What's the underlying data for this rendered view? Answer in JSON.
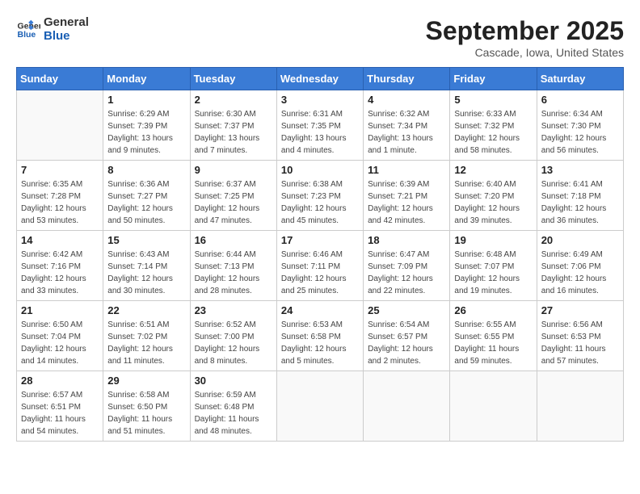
{
  "header": {
    "logo_line1": "General",
    "logo_line2": "Blue",
    "month_title": "September 2025",
    "subtitle": "Cascade, Iowa, United States"
  },
  "weekdays": [
    "Sunday",
    "Monday",
    "Tuesday",
    "Wednesday",
    "Thursday",
    "Friday",
    "Saturday"
  ],
  "weeks": [
    [
      {
        "day": "",
        "detail": ""
      },
      {
        "day": "1",
        "detail": "Sunrise: 6:29 AM\nSunset: 7:39 PM\nDaylight: 13 hours\nand 9 minutes."
      },
      {
        "day": "2",
        "detail": "Sunrise: 6:30 AM\nSunset: 7:37 PM\nDaylight: 13 hours\nand 7 minutes."
      },
      {
        "day": "3",
        "detail": "Sunrise: 6:31 AM\nSunset: 7:35 PM\nDaylight: 13 hours\nand 4 minutes."
      },
      {
        "day": "4",
        "detail": "Sunrise: 6:32 AM\nSunset: 7:34 PM\nDaylight: 13 hours\nand 1 minute."
      },
      {
        "day": "5",
        "detail": "Sunrise: 6:33 AM\nSunset: 7:32 PM\nDaylight: 12 hours\nand 58 minutes."
      },
      {
        "day": "6",
        "detail": "Sunrise: 6:34 AM\nSunset: 7:30 PM\nDaylight: 12 hours\nand 56 minutes."
      }
    ],
    [
      {
        "day": "7",
        "detail": "Sunrise: 6:35 AM\nSunset: 7:28 PM\nDaylight: 12 hours\nand 53 minutes."
      },
      {
        "day": "8",
        "detail": "Sunrise: 6:36 AM\nSunset: 7:27 PM\nDaylight: 12 hours\nand 50 minutes."
      },
      {
        "day": "9",
        "detail": "Sunrise: 6:37 AM\nSunset: 7:25 PM\nDaylight: 12 hours\nand 47 minutes."
      },
      {
        "day": "10",
        "detail": "Sunrise: 6:38 AM\nSunset: 7:23 PM\nDaylight: 12 hours\nand 45 minutes."
      },
      {
        "day": "11",
        "detail": "Sunrise: 6:39 AM\nSunset: 7:21 PM\nDaylight: 12 hours\nand 42 minutes."
      },
      {
        "day": "12",
        "detail": "Sunrise: 6:40 AM\nSunset: 7:20 PM\nDaylight: 12 hours\nand 39 minutes."
      },
      {
        "day": "13",
        "detail": "Sunrise: 6:41 AM\nSunset: 7:18 PM\nDaylight: 12 hours\nand 36 minutes."
      }
    ],
    [
      {
        "day": "14",
        "detail": "Sunrise: 6:42 AM\nSunset: 7:16 PM\nDaylight: 12 hours\nand 33 minutes."
      },
      {
        "day": "15",
        "detail": "Sunrise: 6:43 AM\nSunset: 7:14 PM\nDaylight: 12 hours\nand 30 minutes."
      },
      {
        "day": "16",
        "detail": "Sunrise: 6:44 AM\nSunset: 7:13 PM\nDaylight: 12 hours\nand 28 minutes."
      },
      {
        "day": "17",
        "detail": "Sunrise: 6:46 AM\nSunset: 7:11 PM\nDaylight: 12 hours\nand 25 minutes."
      },
      {
        "day": "18",
        "detail": "Sunrise: 6:47 AM\nSunset: 7:09 PM\nDaylight: 12 hours\nand 22 minutes."
      },
      {
        "day": "19",
        "detail": "Sunrise: 6:48 AM\nSunset: 7:07 PM\nDaylight: 12 hours\nand 19 minutes."
      },
      {
        "day": "20",
        "detail": "Sunrise: 6:49 AM\nSunset: 7:06 PM\nDaylight: 12 hours\nand 16 minutes."
      }
    ],
    [
      {
        "day": "21",
        "detail": "Sunrise: 6:50 AM\nSunset: 7:04 PM\nDaylight: 12 hours\nand 14 minutes."
      },
      {
        "day": "22",
        "detail": "Sunrise: 6:51 AM\nSunset: 7:02 PM\nDaylight: 12 hours\nand 11 minutes."
      },
      {
        "day": "23",
        "detail": "Sunrise: 6:52 AM\nSunset: 7:00 PM\nDaylight: 12 hours\nand 8 minutes."
      },
      {
        "day": "24",
        "detail": "Sunrise: 6:53 AM\nSunset: 6:58 PM\nDaylight: 12 hours\nand 5 minutes."
      },
      {
        "day": "25",
        "detail": "Sunrise: 6:54 AM\nSunset: 6:57 PM\nDaylight: 12 hours\nand 2 minutes."
      },
      {
        "day": "26",
        "detail": "Sunrise: 6:55 AM\nSunset: 6:55 PM\nDaylight: 11 hours\nand 59 minutes."
      },
      {
        "day": "27",
        "detail": "Sunrise: 6:56 AM\nSunset: 6:53 PM\nDaylight: 11 hours\nand 57 minutes."
      }
    ],
    [
      {
        "day": "28",
        "detail": "Sunrise: 6:57 AM\nSunset: 6:51 PM\nDaylight: 11 hours\nand 54 minutes."
      },
      {
        "day": "29",
        "detail": "Sunrise: 6:58 AM\nSunset: 6:50 PM\nDaylight: 11 hours\nand 51 minutes."
      },
      {
        "day": "30",
        "detail": "Sunrise: 6:59 AM\nSunset: 6:48 PM\nDaylight: 11 hours\nand 48 minutes."
      },
      {
        "day": "",
        "detail": ""
      },
      {
        "day": "",
        "detail": ""
      },
      {
        "day": "",
        "detail": ""
      },
      {
        "day": "",
        "detail": ""
      }
    ]
  ]
}
